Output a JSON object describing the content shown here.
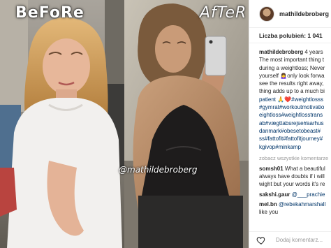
{
  "photo": {
    "before_stamp": "BeFoRe",
    "after_stamp": "AfTeR",
    "watermark": "@mathildebroberg"
  },
  "post": {
    "username": "mathildebroberg",
    "likes": "Liczba polubień: 1 041",
    "caption_user": "mathildebroberg",
    "caption_lines": [
      "4 years",
      "The most important thing t",
      "during a weightloss; Never",
      "yourself 🙍‍♀️only look forwa",
      "see the results right away,",
      "thing adds up to a much bi",
      "patient 🙏❤️#weightlosss",
      "#gymrat#workoutmotivatio",
      "eightloss#weightlosstrans",
      "ab#vægttabsrejse#aarhus",
      "danmark#obesetobeast#",
      "ss#fattofit#fattofitjourney#",
      "kgivop#minkamp"
    ],
    "more_label": "zobacz wszystkie komentarze",
    "comments": [
      {
        "user": "somsh01",
        "lines": [
          "What a beautiful",
          "always have doubts if i will",
          "wight but your words it's re"
        ]
      },
      {
        "user": "sakshi.gaur",
        "lines": [
          "@___prachie"
        ]
      },
      {
        "user": "mel.bn",
        "lines": [
          "@rebekahmarshall",
          "like you"
        ]
      }
    ],
    "comment_placeholder": "Dodaj komentarz...",
    "icons": {
      "heart": "heart-icon",
      "avatar": "avatar"
    }
  }
}
